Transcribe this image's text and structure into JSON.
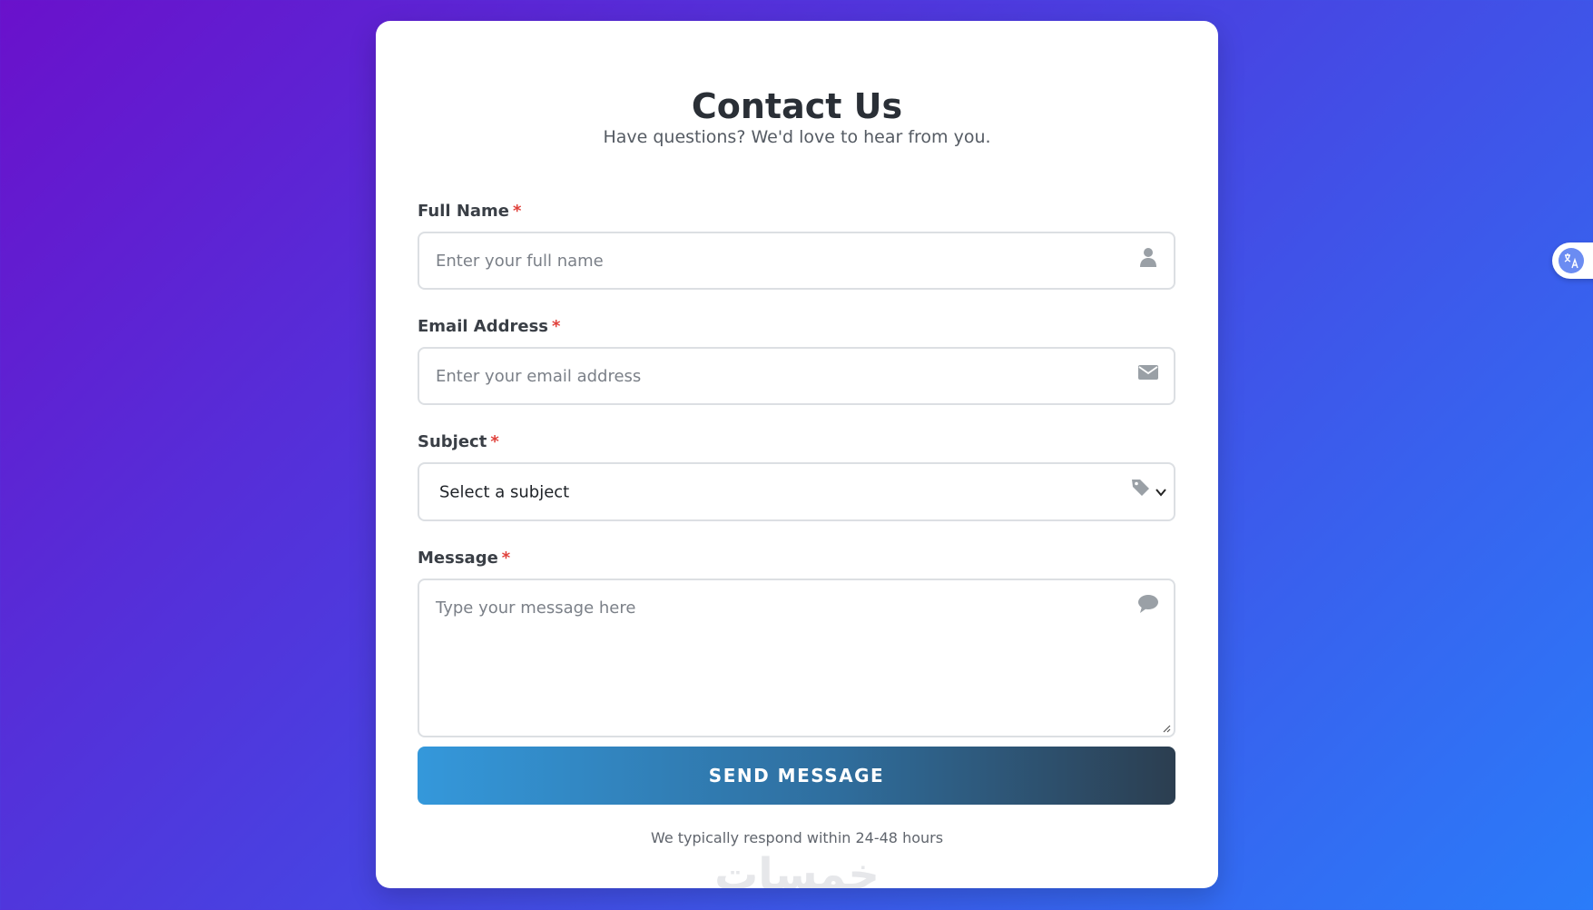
{
  "form": {
    "title": "Contact Us",
    "subtitle": "Have questions? We'd love to hear from you.",
    "required_mark": "*",
    "full_name": {
      "label": "Full Name",
      "placeholder": "Enter your full name",
      "value": "",
      "icon": "user-icon"
    },
    "email": {
      "label": "Email Address",
      "placeholder": "Enter your email address",
      "value": "",
      "icon": "envelope-icon"
    },
    "subject": {
      "label": "Subject",
      "selected": "Select a subject",
      "icon": "tag-icon"
    },
    "message": {
      "label": "Message",
      "placeholder": "Type your message here",
      "value": "",
      "icon": "comment-icon"
    },
    "send_label": "SEND MESSAGE",
    "footnote": "We typically respond within 24-48 hours",
    "watermark": "خمسات"
  },
  "colors": {
    "background_start": "#6a11cb",
    "background_end": "#2a7cf9",
    "button_start": "#3498db",
    "button_end": "#2c3e50",
    "required": "#e0413b"
  },
  "translate_widget": {
    "icon": "translate-icon"
  }
}
